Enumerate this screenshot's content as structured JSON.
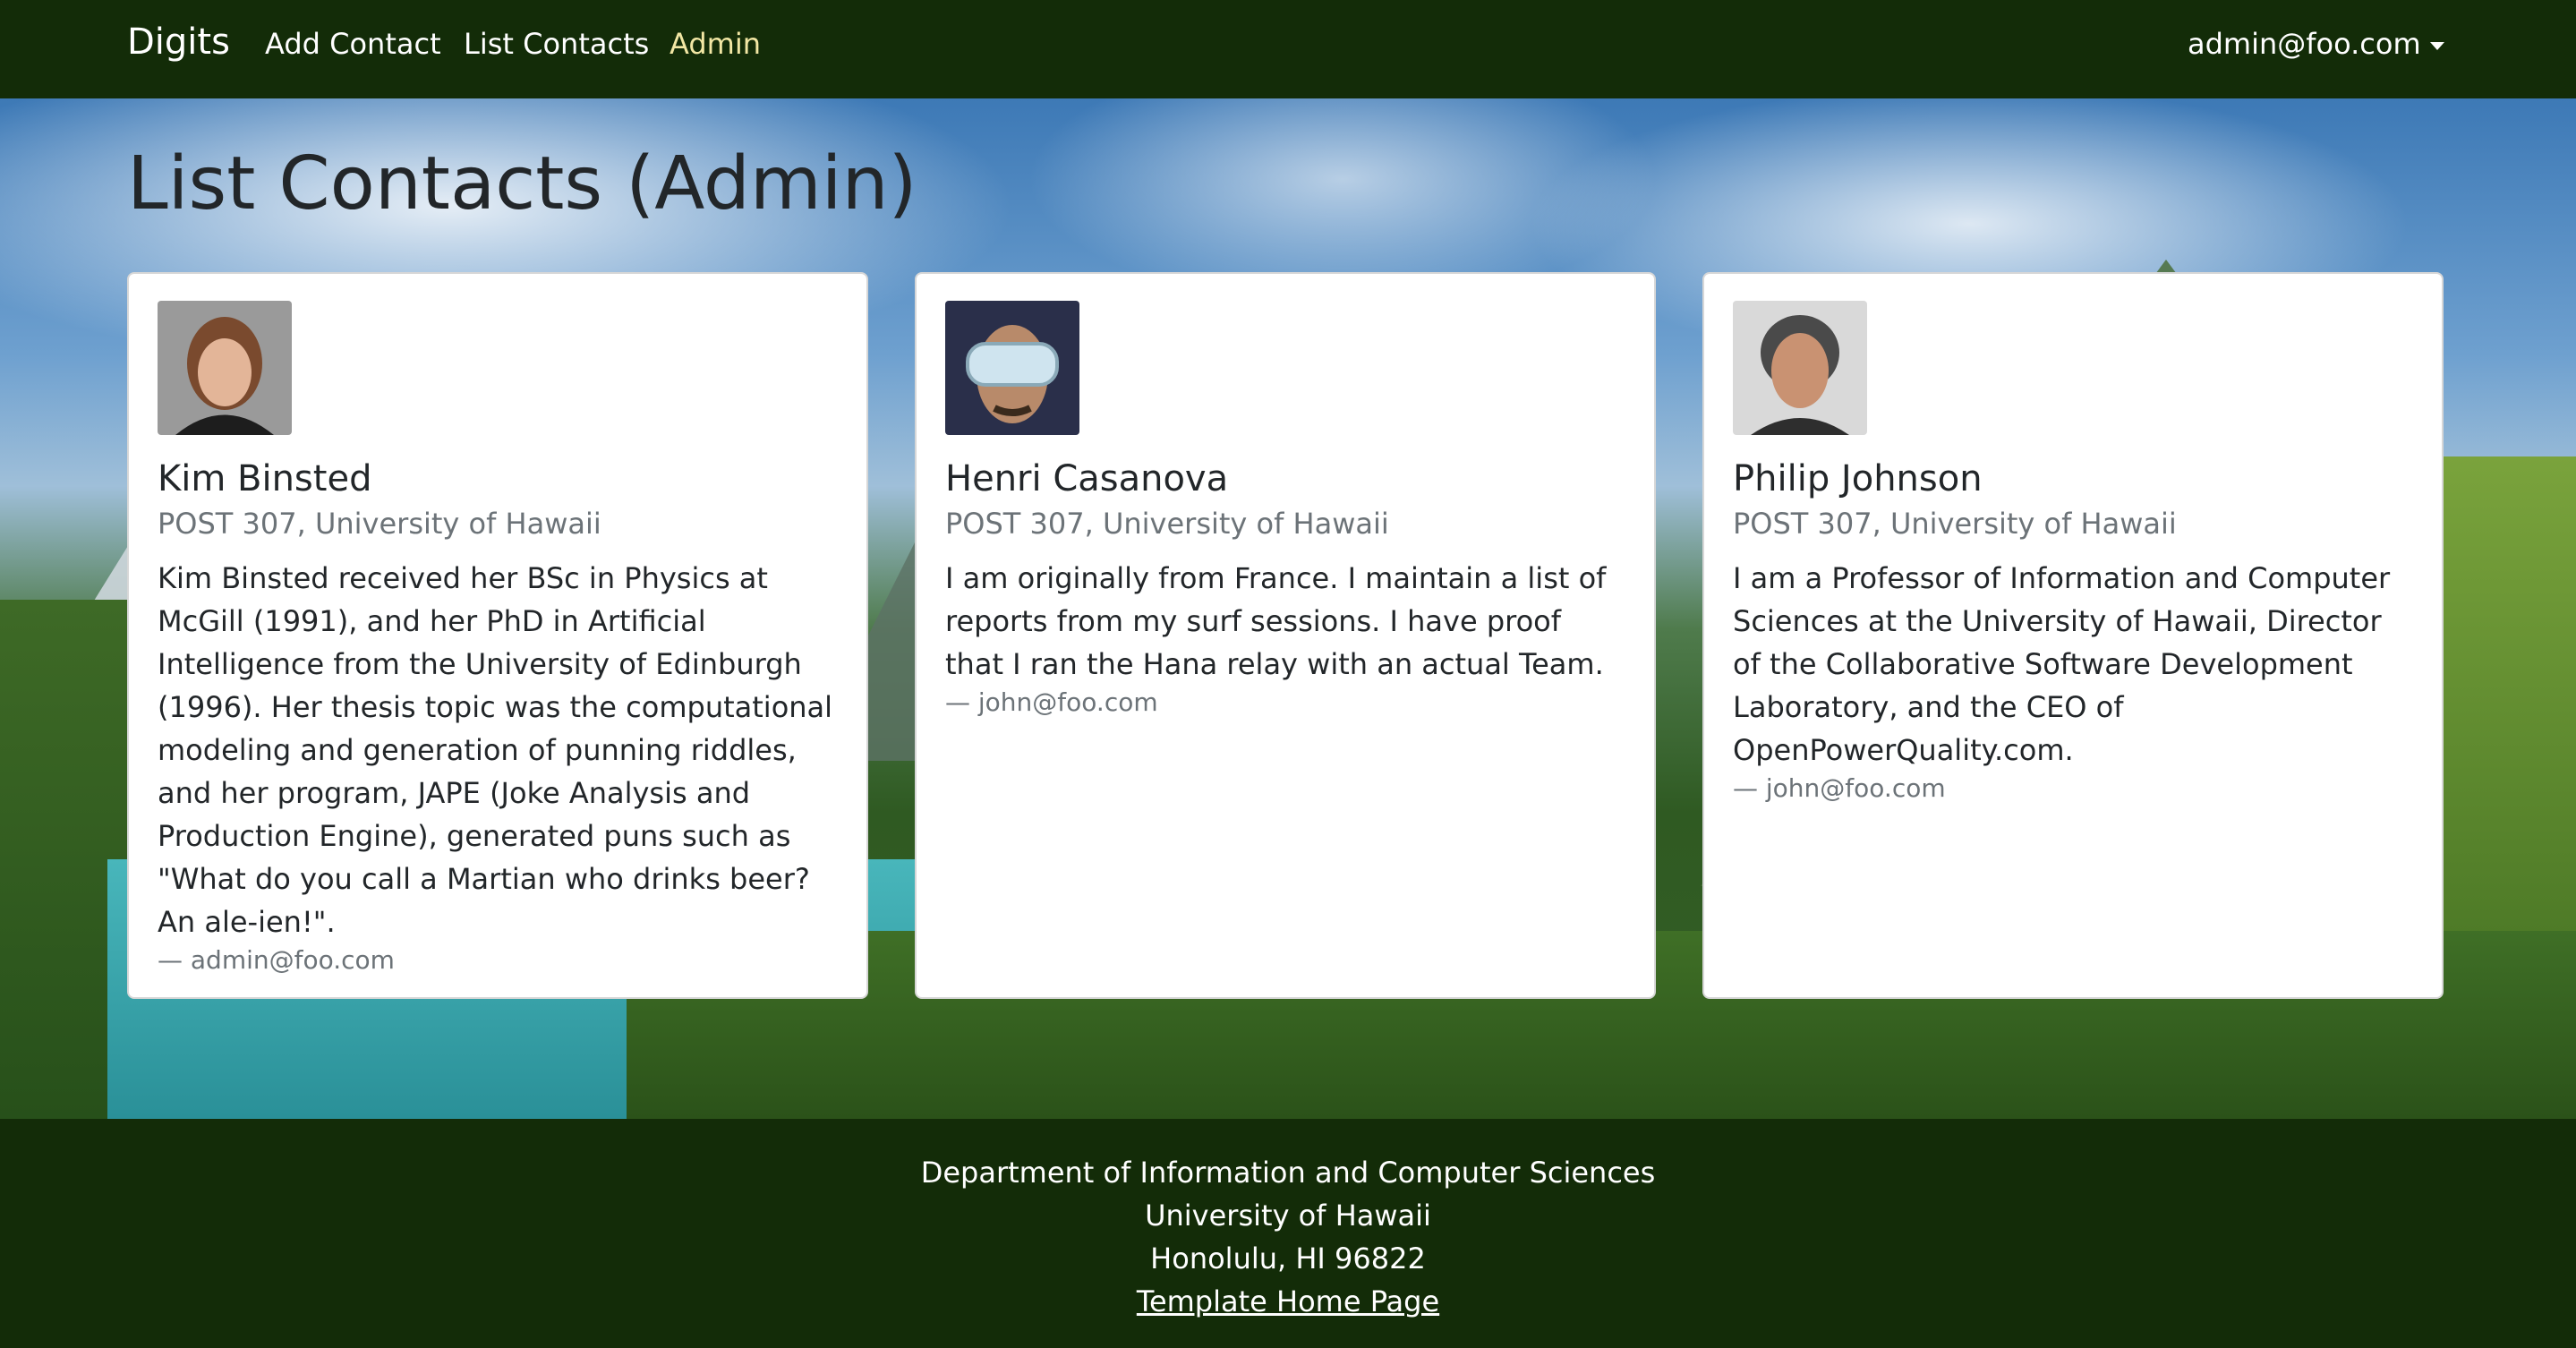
{
  "navbar": {
    "brand": "Digits",
    "links": [
      "Add Contact",
      "List Contacts",
      "Admin"
    ],
    "user": "admin@foo.com"
  },
  "page": {
    "title": "List Contacts (Admin)"
  },
  "contacts": [
    {
      "name": "Kim Binsted",
      "address": "POST 307, University of Hawaii",
      "description": "Kim Binsted received her BSc in Physics at McGill (1991), and her PhD in Artificial Intelligence from the University of Edinburgh (1996). Her thesis topic was the computational modeling and generation of punning riddles, and her program, JAPE (Joke Analysis and Production Engine), generated puns such as \"What do you call a Martian who drinks beer? An ale-ien!\".",
      "owner": "— admin@foo.com"
    },
    {
      "name": "Henri Casanova",
      "address": "POST 307, University of Hawaii",
      "description": "I am originally from France. I maintain a list of reports from my surf sessions. I have proof that I ran the Hana relay with an actual Team.",
      "owner": "— john@foo.com"
    },
    {
      "name": "Philip Johnson",
      "address": "POST 307, University of Hawaii",
      "description": "I am a Professor of Information and Computer Sciences at the University of Hawaii, Director of the Collaborative Software Development Laboratory, and the CEO of OpenPowerQuality.com.",
      "owner": "— john@foo.com"
    }
  ],
  "footer": {
    "line1": "Department of Information and Computer Sciences",
    "line2": "University of Hawaii",
    "line3": "Honolulu, HI 96822",
    "link": "Template Home Page"
  },
  "colors": {
    "navbar_bg": "#132c08",
    "admin_link": "#f2e7a4",
    "card_bg": "#ffffff",
    "muted_text": "#6c7378"
  }
}
